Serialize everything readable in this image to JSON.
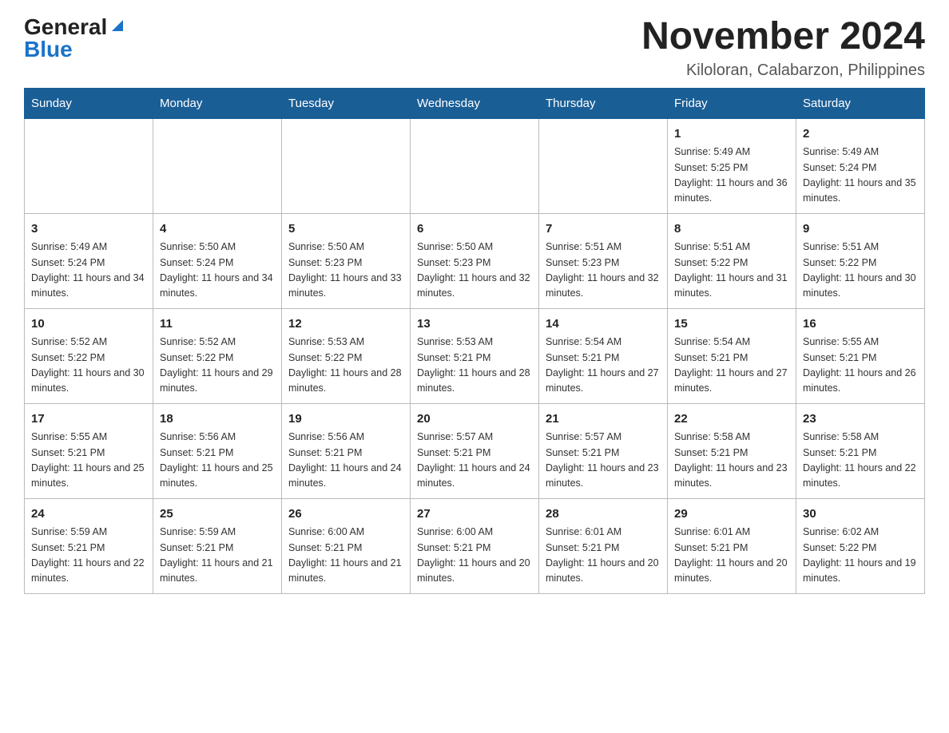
{
  "header": {
    "logo_general": "General",
    "logo_blue": "Blue",
    "title": "November 2024",
    "subtitle": "Kiloloran, Calabarzon, Philippines"
  },
  "days_of_week": [
    "Sunday",
    "Monday",
    "Tuesday",
    "Wednesday",
    "Thursday",
    "Friday",
    "Saturday"
  ],
  "weeks": [
    [
      {
        "day": "",
        "info": ""
      },
      {
        "day": "",
        "info": ""
      },
      {
        "day": "",
        "info": ""
      },
      {
        "day": "",
        "info": ""
      },
      {
        "day": "",
        "info": ""
      },
      {
        "day": "1",
        "info": "Sunrise: 5:49 AM\nSunset: 5:25 PM\nDaylight: 11 hours and 36 minutes."
      },
      {
        "day": "2",
        "info": "Sunrise: 5:49 AM\nSunset: 5:24 PM\nDaylight: 11 hours and 35 minutes."
      }
    ],
    [
      {
        "day": "3",
        "info": "Sunrise: 5:49 AM\nSunset: 5:24 PM\nDaylight: 11 hours and 34 minutes."
      },
      {
        "day": "4",
        "info": "Sunrise: 5:50 AM\nSunset: 5:24 PM\nDaylight: 11 hours and 34 minutes."
      },
      {
        "day": "5",
        "info": "Sunrise: 5:50 AM\nSunset: 5:23 PM\nDaylight: 11 hours and 33 minutes."
      },
      {
        "day": "6",
        "info": "Sunrise: 5:50 AM\nSunset: 5:23 PM\nDaylight: 11 hours and 32 minutes."
      },
      {
        "day": "7",
        "info": "Sunrise: 5:51 AM\nSunset: 5:23 PM\nDaylight: 11 hours and 32 minutes."
      },
      {
        "day": "8",
        "info": "Sunrise: 5:51 AM\nSunset: 5:22 PM\nDaylight: 11 hours and 31 minutes."
      },
      {
        "day": "9",
        "info": "Sunrise: 5:51 AM\nSunset: 5:22 PM\nDaylight: 11 hours and 30 minutes."
      }
    ],
    [
      {
        "day": "10",
        "info": "Sunrise: 5:52 AM\nSunset: 5:22 PM\nDaylight: 11 hours and 30 minutes."
      },
      {
        "day": "11",
        "info": "Sunrise: 5:52 AM\nSunset: 5:22 PM\nDaylight: 11 hours and 29 minutes."
      },
      {
        "day": "12",
        "info": "Sunrise: 5:53 AM\nSunset: 5:22 PM\nDaylight: 11 hours and 28 minutes."
      },
      {
        "day": "13",
        "info": "Sunrise: 5:53 AM\nSunset: 5:21 PM\nDaylight: 11 hours and 28 minutes."
      },
      {
        "day": "14",
        "info": "Sunrise: 5:54 AM\nSunset: 5:21 PM\nDaylight: 11 hours and 27 minutes."
      },
      {
        "day": "15",
        "info": "Sunrise: 5:54 AM\nSunset: 5:21 PM\nDaylight: 11 hours and 27 minutes."
      },
      {
        "day": "16",
        "info": "Sunrise: 5:55 AM\nSunset: 5:21 PM\nDaylight: 11 hours and 26 minutes."
      }
    ],
    [
      {
        "day": "17",
        "info": "Sunrise: 5:55 AM\nSunset: 5:21 PM\nDaylight: 11 hours and 25 minutes."
      },
      {
        "day": "18",
        "info": "Sunrise: 5:56 AM\nSunset: 5:21 PM\nDaylight: 11 hours and 25 minutes."
      },
      {
        "day": "19",
        "info": "Sunrise: 5:56 AM\nSunset: 5:21 PM\nDaylight: 11 hours and 24 minutes."
      },
      {
        "day": "20",
        "info": "Sunrise: 5:57 AM\nSunset: 5:21 PM\nDaylight: 11 hours and 24 minutes."
      },
      {
        "day": "21",
        "info": "Sunrise: 5:57 AM\nSunset: 5:21 PM\nDaylight: 11 hours and 23 minutes."
      },
      {
        "day": "22",
        "info": "Sunrise: 5:58 AM\nSunset: 5:21 PM\nDaylight: 11 hours and 23 minutes."
      },
      {
        "day": "23",
        "info": "Sunrise: 5:58 AM\nSunset: 5:21 PM\nDaylight: 11 hours and 22 minutes."
      }
    ],
    [
      {
        "day": "24",
        "info": "Sunrise: 5:59 AM\nSunset: 5:21 PM\nDaylight: 11 hours and 22 minutes."
      },
      {
        "day": "25",
        "info": "Sunrise: 5:59 AM\nSunset: 5:21 PM\nDaylight: 11 hours and 21 minutes."
      },
      {
        "day": "26",
        "info": "Sunrise: 6:00 AM\nSunset: 5:21 PM\nDaylight: 11 hours and 21 minutes."
      },
      {
        "day": "27",
        "info": "Sunrise: 6:00 AM\nSunset: 5:21 PM\nDaylight: 11 hours and 20 minutes."
      },
      {
        "day": "28",
        "info": "Sunrise: 6:01 AM\nSunset: 5:21 PM\nDaylight: 11 hours and 20 minutes."
      },
      {
        "day": "29",
        "info": "Sunrise: 6:01 AM\nSunset: 5:21 PM\nDaylight: 11 hours and 20 minutes."
      },
      {
        "day": "30",
        "info": "Sunrise: 6:02 AM\nSunset: 5:22 PM\nDaylight: 11 hours and 19 minutes."
      }
    ]
  ]
}
